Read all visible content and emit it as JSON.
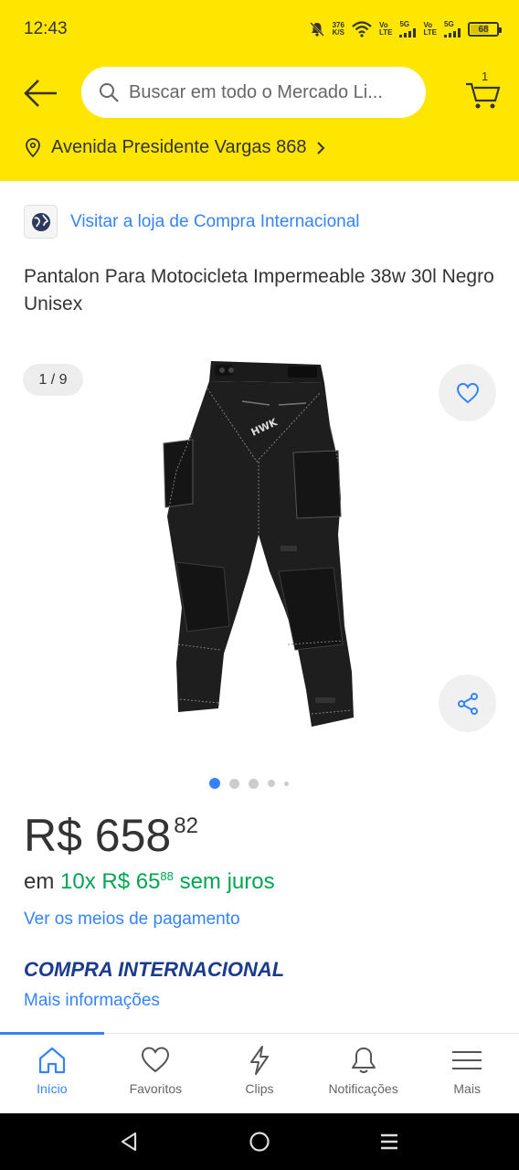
{
  "status_bar": {
    "time": "12:43",
    "net_speed_top": "376",
    "net_speed_bottom": "K/S",
    "volte1_top": "Vo",
    "volte1_bottom": "LTE",
    "net1": "5G",
    "volte2_top": "Vo",
    "volte2_bottom": "LTE",
    "net2": "5G",
    "battery": "68",
    "battery_level": 0.68,
    "icons": [
      "dnd-icon",
      "wifi-icon",
      "signal-icon",
      "battery-icon"
    ]
  },
  "header": {
    "search_placeholder": "Buscar em todo o Mercado Li...",
    "cart_count": "1",
    "location": "Avenida Presidente Vargas 868"
  },
  "product": {
    "store_link": "Visitar a loja de Compra Internacional",
    "title": "Pantalon Para Motocicleta Impermeable 38w 30l Negro Unisex",
    "image_counter": "1 / 9",
    "brand_mark": "HWK",
    "gallery_dots": 5,
    "active_dot": 0,
    "price": {
      "currency_value": "R$ 658",
      "cents": "82"
    },
    "installments": {
      "prefix": "em",
      "count_value": "10x R$ 65",
      "cents": "88",
      "suffix": "sem juros"
    },
    "payment_link": "Ver os meios de pagamento",
    "intl_label": "COMPRA INTERNACIONAL",
    "more_info": "Mais informações"
  },
  "bottom_nav": {
    "items": [
      {
        "label": "Início",
        "icon": "home-icon",
        "active": true
      },
      {
        "label": "Favoritos",
        "icon": "heart-icon",
        "active": false
      },
      {
        "label": "Clips",
        "icon": "lightning-icon",
        "active": false
      },
      {
        "label": "Notificações",
        "icon": "bell-icon",
        "active": false
      },
      {
        "label": "Mais",
        "icon": "menu-icon",
        "active": false
      }
    ]
  },
  "colors": {
    "header_yellow": "#FFE600",
    "link_blue": "#3483FA",
    "green": "#00A650",
    "intl_navy": "#1a3c8c"
  }
}
